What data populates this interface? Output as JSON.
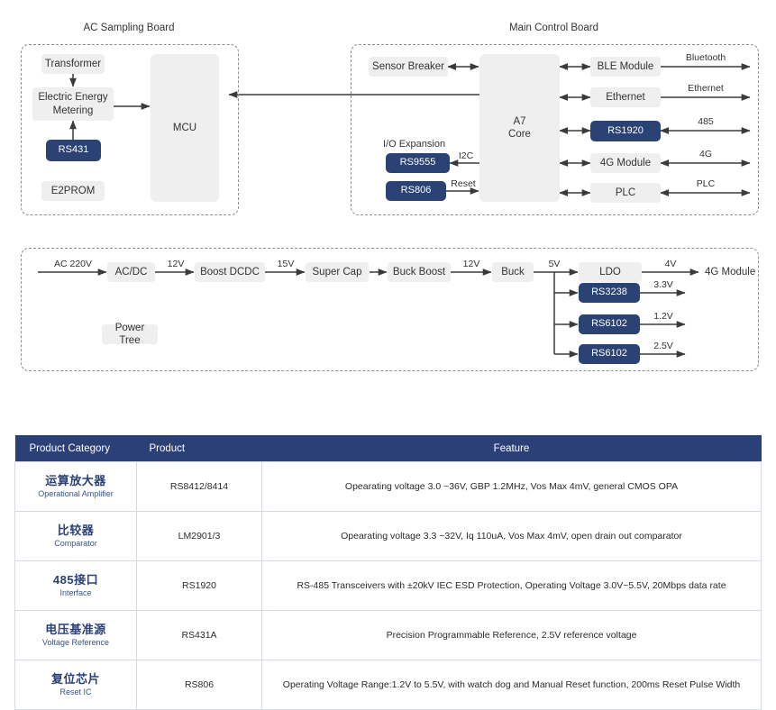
{
  "diagram": {
    "groups": [
      {
        "id": "ac-sampling-board",
        "title": "AC Sampling Board"
      },
      {
        "id": "main-control-board",
        "title": "Main Control Board"
      },
      {
        "id": "power-tree",
        "title": ""
      }
    ],
    "ac_sampling_board": {
      "title": "AC Sampling Board",
      "nodes": [
        {
          "id": "transformer",
          "label": "Transformer",
          "style": "grey"
        },
        {
          "id": "electric-energy-metering",
          "label": "Electric Energy\nMetering",
          "style": "grey"
        },
        {
          "id": "rs431",
          "label": "RS431",
          "style": "blue"
        },
        {
          "id": "e2prom",
          "label": "E2PROM",
          "style": "grey"
        },
        {
          "id": "mcu",
          "label": "MCU",
          "style": "grey"
        }
      ]
    },
    "main_control_board": {
      "title": "Main Control Board",
      "core": {
        "id": "a7-core",
        "label": "A7\nCore",
        "style": "grey"
      },
      "left_nodes": [
        {
          "id": "sensor-breaker",
          "label": "Sensor Breaker",
          "style": "grey"
        },
        {
          "id": "rs9555",
          "label": "RS9555",
          "style": "blue"
        },
        {
          "id": "rs806",
          "label": "RS806",
          "style": "blue"
        }
      ],
      "io_expansion_caption": "I/O Expansion",
      "left_wire_labels": [
        {
          "id": "i2c",
          "label": "I2C"
        },
        {
          "id": "reset",
          "label": "Reset"
        }
      ],
      "right_nodes": [
        {
          "id": "ble-module",
          "label": "BLE Module",
          "style": "grey"
        },
        {
          "id": "ethernet-module",
          "label": "Ethernet",
          "style": "grey"
        },
        {
          "id": "rs1920",
          "label": "RS1920",
          "style": "blue"
        },
        {
          "id": "4g-module",
          "label": "4G Module",
          "style": "grey"
        },
        {
          "id": "plc-module",
          "label": "PLC",
          "style": "grey"
        }
      ],
      "right_wire_labels": [
        {
          "id": "bluetooth",
          "label": "Bluetooth"
        },
        {
          "id": "ethernet",
          "label": "Ethernet"
        },
        {
          "id": "485",
          "label": "485"
        },
        {
          "id": "4g",
          "label": "4G"
        },
        {
          "id": "plc",
          "label": "PLC"
        }
      ]
    },
    "power_tree": {
      "caption": "Power Tree",
      "chain": [
        {
          "id": "ac-dc",
          "label": "AC/DC",
          "style": "grey"
        },
        {
          "id": "boost-dcdc",
          "label": "Boost DCDC",
          "style": "grey"
        },
        {
          "id": "super-cap",
          "label": "Super Cap",
          "style": "grey"
        },
        {
          "id": "buck-boost",
          "label": "Buck Boost",
          "style": "grey"
        },
        {
          "id": "buck",
          "label": "Buck",
          "style": "grey"
        }
      ],
      "chain_labels": [
        {
          "id": "ac-220v",
          "label": "AC 220V"
        },
        {
          "id": "12v-a",
          "label": "12V"
        },
        {
          "id": "15v",
          "label": "15V"
        },
        {
          "id": "12v-b",
          "label": "12V"
        },
        {
          "id": "5v",
          "label": "5V"
        }
      ],
      "rails": [
        {
          "id": "ldo",
          "label": "LDO",
          "style": "grey",
          "out": "4V",
          "load": "4G Module"
        },
        {
          "id": "rs3238",
          "label": "RS3238",
          "style": "blue",
          "out": "3.3V",
          "load": ""
        },
        {
          "id": "rs6102-a",
          "label": "RS6102",
          "style": "blue",
          "out": "1.2V",
          "load": ""
        },
        {
          "id": "rs6102-b",
          "label": "RS6102",
          "style": "blue",
          "out": "2.5V",
          "load": ""
        }
      ]
    }
  },
  "table": {
    "headers": [
      "Product Category",
      "Product",
      "Feature"
    ],
    "rows": [
      {
        "category_zh": "运算放大器",
        "category_en": "Operational Amplifier",
        "product": "RS8412/8414",
        "feature": "Opearating voltage 3.0 ~36V, GBP 1.2MHz,  Vos Max 4mV, general CMOS OPA"
      },
      {
        "category_zh": "比较器",
        "category_en": "Comparator",
        "product": "LM2901/3",
        "feature": "Opearating voltage 3.3 ~32V, Iq 110uA,  Vos Max 4mV, open drain out comparator"
      },
      {
        "category_zh": "485接口",
        "category_en": "Interface",
        "product": "RS1920",
        "feature": "RS-485 Transceivers with ±20kV IEC ESD Protection,  Operating Voltage 3.0V~5.5V,  20Mbps data rate"
      },
      {
        "category_zh": "电压基准源",
        "category_en": "Voltage Reference",
        "product": "RS431A",
        "feature": "Precision Programmable Reference, 2.5V reference voltage"
      },
      {
        "category_zh": "复位芯片",
        "category_en": "Reset IC",
        "product": "RS806",
        "feature": "Operating Voltage Range:1.2V to 5.5V,  with watch dog and Manual Reset function,  200ms Reset Pulse Width"
      }
    ]
  },
  "colors": {
    "brand_blue": "#2a4374",
    "table_header_blue": "#2b4077",
    "node_grey": "#efefef",
    "frame_dash": "#8d8d8d",
    "wire": "#3a3a3a"
  }
}
